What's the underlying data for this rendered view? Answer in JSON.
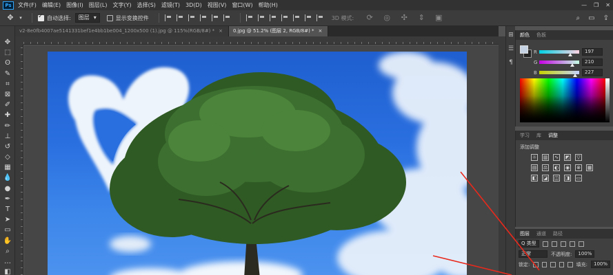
{
  "app": {
    "logo": "Ps"
  },
  "menu": [
    "文件(F)",
    "编辑(E)",
    "图像(I)",
    "图层(L)",
    "文字(Y)",
    "选择(S)",
    "滤镜(T)",
    "3D(D)",
    "视图(V)",
    "窗口(W)",
    "帮助(H)"
  ],
  "window_controls": [
    "—",
    "❐",
    "✕"
  ],
  "options": {
    "auto_select_label": "自动选择:",
    "auto_select_value": "图层",
    "show_transform_label": "显示变换控件",
    "mode_3d_label": "3D 模式:"
  },
  "tabs": [
    {
      "label": "v2-8e0fb4007ae5141331bef1e4bb1be004_1200x500 (1).jpg @ 115%(RGB/8#) *",
      "close": "×"
    },
    {
      "label": "0.jpg @ 51.2% (图层 2, RGB/8#) *",
      "close": "×"
    }
  ],
  "color_panel": {
    "tabs": [
      "颜色",
      "色板"
    ],
    "foreground": "#c5d2e3",
    "channels": [
      {
        "letter": "R",
        "value": "197",
        "fraction": 0.77,
        "gradient": "linear-gradient(90deg,#00d2e3,#ffd2e3)"
      },
      {
        "letter": "G",
        "value": "210",
        "fraction": 0.82,
        "gradient": "linear-gradient(90deg,#c500e3,#c5ffe3)"
      },
      {
        "letter": "B",
        "value": "227",
        "fraction": 0.89,
        "gradient": "linear-gradient(90deg,#c5d200,#c5d2ff)"
      }
    ]
  },
  "adjustments_panel": {
    "tabs": [
      "学习",
      "库",
      "调整"
    ],
    "title": "添加调整"
  },
  "layers_panel": {
    "tabs": [
      "图层",
      "通道",
      "路径"
    ],
    "kind_label": "Q 类型",
    "blend_mode": "正常",
    "opacity_label": "不透明度:",
    "opacity_value": "100%",
    "lock_label": "锁定:",
    "fill_label": "填充:",
    "fill_value": "100%"
  },
  "accent_annotation_color": "#e8291c"
}
